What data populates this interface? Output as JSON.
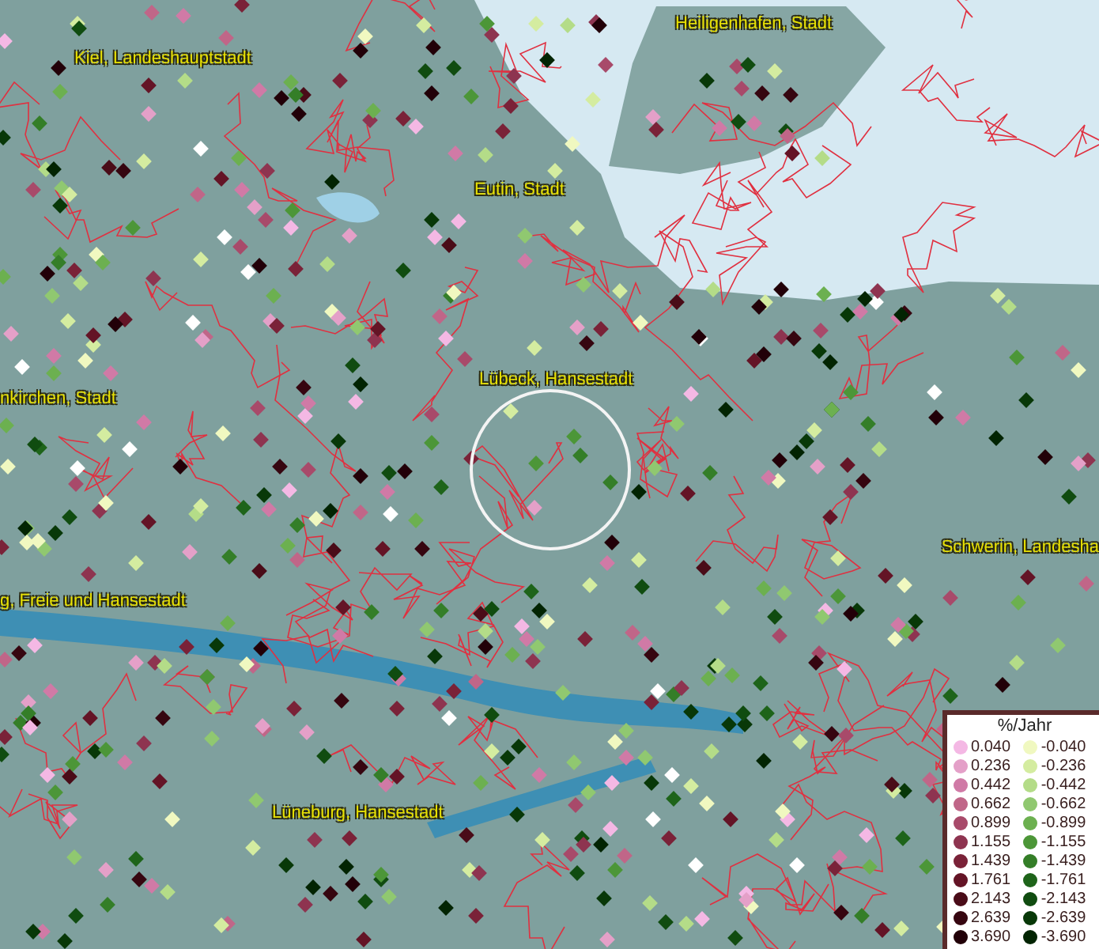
{
  "map": {
    "places": [
      {
        "name": "Heiligenhafen, Stadt"
      },
      {
        "name": "Kiel, Landeshauptstadt"
      },
      {
        "name": "Eutin, Stadt"
      },
      {
        "name": "Lübeck, Hansestadt"
      },
      {
        "name": "nkirchen, Stadt"
      },
      {
        "name": "Schwerin, Landesha"
      },
      {
        "name": "g, Freie und Hansestadt"
      },
      {
        "name": "Lüneburg, Hansestadt"
      }
    ]
  },
  "legend": {
    "title": "%/Jahr",
    "items": [
      {
        "label": "0.040",
        "color": "#f4b8e4"
      },
      {
        "label": "-0.040",
        "color": "#f0f8c0"
      },
      {
        "label": "0.236",
        "color": "#e4a0c8"
      },
      {
        "label": "-0.236",
        "color": "#d4eca0"
      },
      {
        "label": "0.442",
        "color": "#d07aa6"
      },
      {
        "label": "-0.442",
        "color": "#b4dc88"
      },
      {
        "label": "0.662",
        "color": "#c06688"
      },
      {
        "label": "-0.662",
        "color": "#90c870"
      },
      {
        "label": "0.899",
        "color": "#a84a6a"
      },
      {
        "label": "-0.899",
        "color": "#6cb050"
      },
      {
        "label": "1.155",
        "color": "#8e3450"
      },
      {
        "label": "-1.155",
        "color": "#4c9638"
      },
      {
        "label": "1.439",
        "color": "#7a2238"
      },
      {
        "label": "-1.439",
        "color": "#347e28"
      },
      {
        "label": "1.761",
        "color": "#641426"
      },
      {
        "label": "-1.761",
        "color": "#1e641a"
      },
      {
        "label": "2.143",
        "color": "#4a0c18"
      },
      {
        "label": "-2.143",
        "color": "#104c10"
      },
      {
        "label": "2.639",
        "color": "#360610"
      },
      {
        "label": "-2.639",
        "color": "#083808"
      },
      {
        "label": "3.690",
        "color": "#220008"
      },
      {
        "label": "-3.690",
        "color": "#022402"
      }
    ]
  }
}
